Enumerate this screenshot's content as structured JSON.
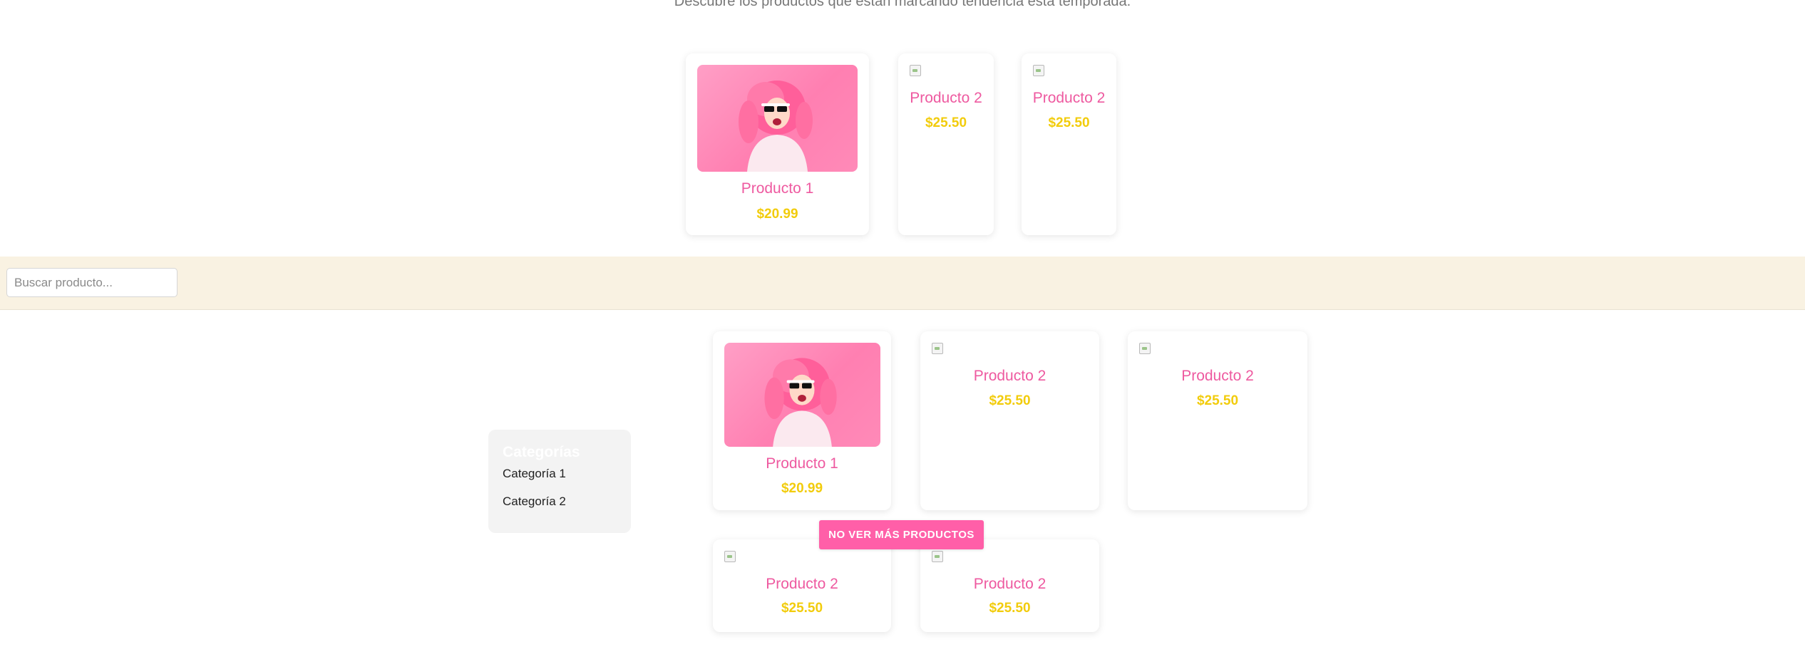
{
  "header": {
    "subtitle": "Descubre los productos que están marcando tendencia esta temporada."
  },
  "featured": {
    "products": [
      {
        "name": "Producto 1",
        "price": "$20.99",
        "image": "pink-hair-woman-photo"
      },
      {
        "name": "Producto 2",
        "price": "$25.50",
        "image": "broken-image-icon"
      },
      {
        "name": "Producto 2",
        "price": "$25.50",
        "image": "broken-image-icon"
      }
    ]
  },
  "search": {
    "placeholder": "Buscar producto..."
  },
  "sidebar": {
    "title": "Categorías",
    "items": [
      "Categoría 1",
      "Categoría 2"
    ]
  },
  "catalog": {
    "products": [
      {
        "name": "Producto 1",
        "price": "$20.99",
        "image": "pink-hair-woman-photo"
      },
      {
        "name": "Producto 2",
        "price": "$25.50",
        "image": "broken-image-icon"
      },
      {
        "name": "Producto 2",
        "price": "$25.50",
        "image": "broken-image-icon"
      },
      {
        "name": "Producto 2",
        "price": "$25.50",
        "image": "broken-image-icon"
      },
      {
        "name": "Producto 2",
        "price": "$25.50",
        "image": "broken-image-icon"
      }
    ],
    "more_button_label": "NO VER MÁS PRODUCTOS"
  },
  "colors": {
    "accent_pink": "#ff5fa8",
    "product_name": "#ee5aa0",
    "price_yellow": "#f2cc0c",
    "search_band": "#f9f2e2"
  }
}
